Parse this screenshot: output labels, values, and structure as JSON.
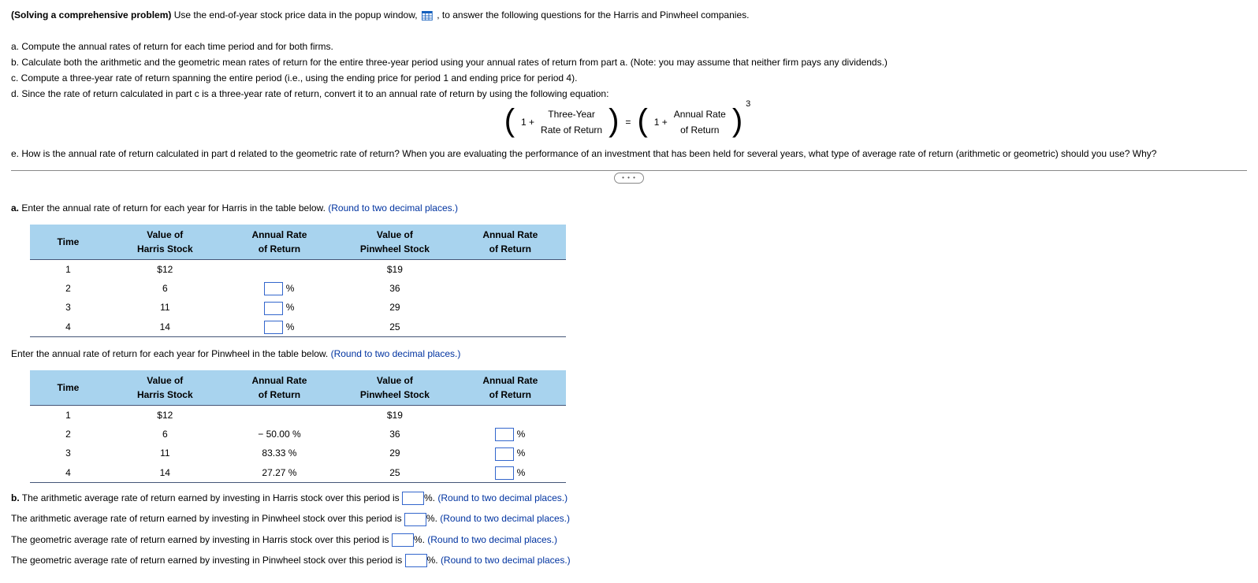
{
  "intro": {
    "lead_bold": "(Solving a comprehensive problem)",
    "lead_rest": " Use the end-of-year stock price data in the popup window, ",
    "lead_tail": " , to answer the following questions for the Harris and Pinwheel companies."
  },
  "parts": {
    "a": "a. Compute the annual rates of return for each time period and for both firms.",
    "b": "b. Calculate both the arithmetic and the geometric mean rates of return for the entire three-year period using your annual rates of return from part a. (Note: you may assume that neither firm pays any dividends.)",
    "c": "c. Compute a three-year rate of return spanning the entire period (i.e., using the ending price for period 1 and ending price for period 4).",
    "d": "d. Since the rate of return calculated in part c is a three-year rate of return, convert it to an annual rate of return by using the following equation:",
    "e": "e. How is the annual rate of return calculated in part d related to the geometric rate of return? When you are evaluating the performance of an investment that has been held for several years, what type of average rate of return (arithmetic or geometric) should you use? Why?"
  },
  "equation": {
    "one_plus_a": "1 +",
    "left_top": "Three-Year",
    "left_bot": "Rate of Return",
    "equals": "=",
    "one_plus_b": "1 +",
    "right_top": "Annual Rate",
    "right_bot": "of Return",
    "exp": "3"
  },
  "section_a": {
    "prompt_lead_bold": "a.",
    "prompt_lead": " Enter the annual rate of return for each year for Harris in the table below.  ",
    "prompt_hint": "(Round to two decimal places.)",
    "prompt2": "Enter the annual rate of return for each year for Pinwheel in the table below.  ",
    "prompt2_hint": "(Round to two decimal places.)"
  },
  "headers": {
    "time": "Time",
    "harris_val": "Value of\nHarris Stock",
    "harris_ror": "Annual Rate\nof Return",
    "pin_val": "Value of\nPinwheel Stock",
    "pin_ror": "Annual Rate\nof Return"
  },
  "table1": {
    "rows": [
      {
        "time": "1",
        "hv": "$12",
        "hrr": "",
        "pv": "$19",
        "prr": ""
      },
      {
        "time": "2",
        "hv": "6",
        "hrr_input": true,
        "pv": "36",
        "prr": ""
      },
      {
        "time": "3",
        "hv": "11",
        "hrr_input": true,
        "pv": "29",
        "prr": ""
      },
      {
        "time": "4",
        "hv": "14",
        "hrr_input": true,
        "pv": "25",
        "prr": ""
      }
    ]
  },
  "table2": {
    "rows": [
      {
        "time": "1",
        "hv": "$12",
        "hrr": "",
        "pv": "$19",
        "prr": ""
      },
      {
        "time": "2",
        "hv": "6",
        "hrr": "− 50.00 %",
        "pv": "36",
        "prr_input": true
      },
      {
        "time": "3",
        "hv": "11",
        "hrr": "83.33 %",
        "pv": "29",
        "prr_input": true
      },
      {
        "time": "4",
        "hv": "14",
        "hrr": "27.27 %",
        "pv": "25",
        "prr_input": true
      }
    ]
  },
  "pct": "%",
  "section_b": {
    "lead_bold": "b.",
    "l1a": " The arithmetic average rate of return earned by investing in Harris stock over this period is ",
    "l1b": "%.  ",
    "hint": "(Round to two decimal places.)",
    "l2a": "The arithmetic average rate of return earned by investing in Pinwheel stock over this period is ",
    "l3a": "The geometric average rate of return earned by investing in Harris stock over this period is ",
    "l4a": "The geometric average rate of return earned by investing in Pinwheel stock over this period is "
  },
  "ellipsis": "• • •"
}
